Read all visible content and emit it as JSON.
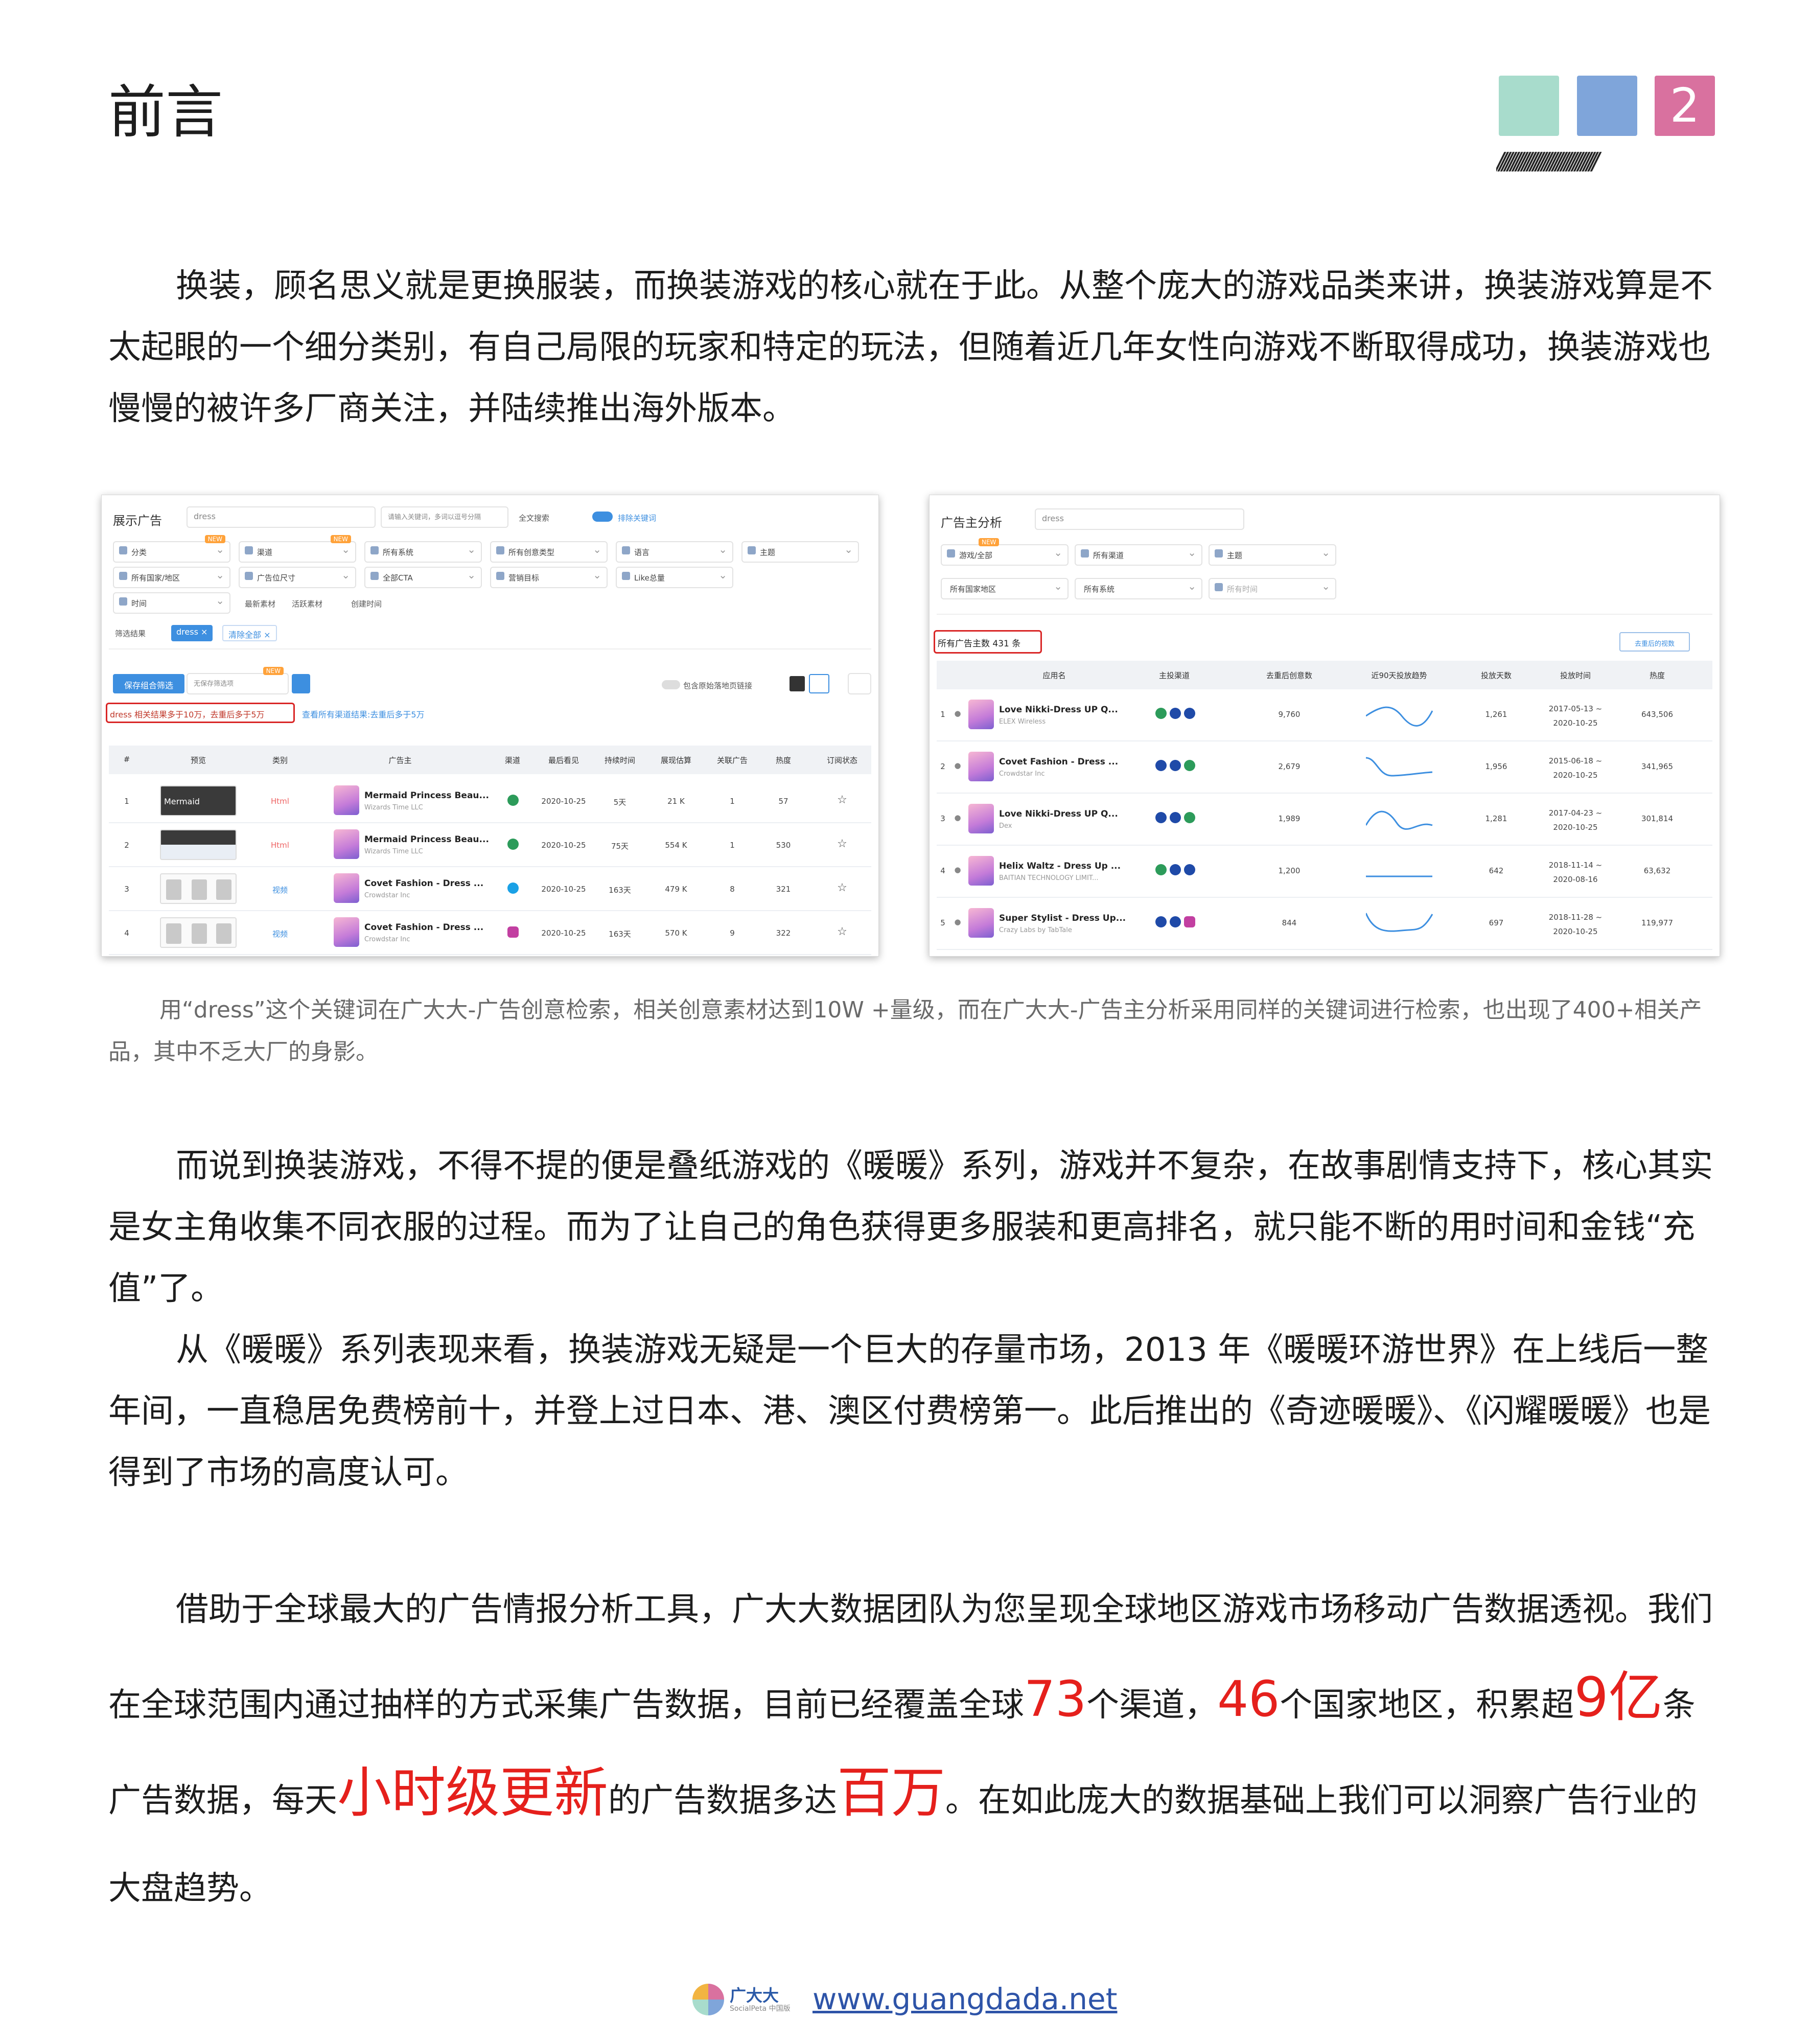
{
  "header": {
    "title": "前言",
    "page_number": "2",
    "slashes": "///////////////////////////////////"
  },
  "intro_paragraph": "换装，顾名思义就是更换服装，而换装游戏的核心就在于此。从整个庞大的游戏品类来讲，换装游戏算是不太起眼的一个细分类别，有自己局限的玩家和特定的玩法，但随着近几年女性向游戏不断取得成功，换装游戏也慢慢的被许多厂商关注，并陆续推出海外版本。",
  "shot_left": {
    "label": "展示广告",
    "search_value": "dress",
    "search_placeholder": "请输入关键词，多词以逗号分隔",
    "fulltext_label": "全文搜索",
    "exclude_label": "排除关键词",
    "filters_row1": [
      "分类",
      "渠道",
      "所有系统",
      "所有创意类型",
      "语言",
      "主题"
    ],
    "filters_row2": [
      "所有国家/地区",
      "广告位尺寸",
      "全部CTA",
      "营销目标",
      "Like总量"
    ],
    "filters_row3": [
      "时间",
      "最新素材",
      "活跃素材",
      "创建时间"
    ],
    "new_badge": "NEW",
    "filter_result_label": "筛选结果",
    "tag_dress": "dress ×",
    "tag_clear": "清除全部 ×",
    "save_btn": "保存组合筛选",
    "save_placeholder": "无保存筛选项",
    "include_label": "包含原始落地页链接",
    "sort_label": "最后看见",
    "result_text": "dress 相关结果多于10万，去重后多于5万",
    "result_link": "查看所有渠道结果:去重后多于5万",
    "columns": [
      "#",
      "预览",
      "类别",
      "广告主",
      "渠道",
      "最后看见",
      "持续时间",
      "展现估算",
      "关联广告",
      "热度",
      "订阅状态"
    ],
    "rows": [
      {
        "n": "1",
        "type": "Html",
        "app": "Mermaid Princess Beau...",
        "dev": "Wizards Time LLC",
        "last": "2020-10-25",
        "dur": "5天",
        "imp": "21 K",
        "rel": "1",
        "heat": "57"
      },
      {
        "n": "2",
        "type": "Html",
        "app": "Mermaid Princess Beau...",
        "dev": "Wizards Time LLC",
        "last": "2020-10-25",
        "dur": "75天",
        "imp": "554 K",
        "rel": "1",
        "heat": "530"
      },
      {
        "n": "3",
        "type": "视频",
        "app": "Covet Fashion - Dress ...",
        "dev": "Crowdstar Inc",
        "last": "2020-10-25",
        "dur": "163天",
        "imp": "479 K",
        "rel": "8",
        "heat": "321"
      },
      {
        "n": "4",
        "type": "视频",
        "app": "Covet Fashion - Dress ...",
        "dev": "Crowdstar Inc",
        "last": "2020-10-25",
        "dur": "163天",
        "imp": "570 K",
        "rel": "9",
        "heat": "322"
      }
    ],
    "thumb_text": "Mermaid"
  },
  "shot_right": {
    "label": "广告主分析",
    "search_value": "dress",
    "filters_row1": [
      "游戏/全部",
      "所有渠道",
      "主题"
    ],
    "filters_row2": [
      "所有国家地区",
      "所有系统",
      "所有时间"
    ],
    "new_badge": "NEW",
    "total_text": "所有广告主数 431 条",
    "dedupe_btn": "去重后的视数",
    "columns": [
      "应用名",
      "主投渠道",
      "去重后创意数",
      "近90天投放趋势",
      "投放天数",
      "投放时间",
      "热度"
    ],
    "rows": [
      {
        "n": "1",
        "app": "Love Nikki-Dress UP Q...",
        "dev": "ELEX Wireless",
        "creatives": "9,760",
        "days": "1,261",
        "time": "2017-05-13 ~ 2020-10-25",
        "heat": "643,506"
      },
      {
        "n": "2",
        "app": "Covet Fashion - Dress ...",
        "dev": "Crowdstar Inc",
        "creatives": "2,679",
        "days": "1,956",
        "time": "2015-06-18 ~ 2020-10-25",
        "heat": "341,965"
      },
      {
        "n": "3",
        "app": "Love Nikki-Dress UP Q...",
        "dev": "Dex",
        "creatives": "1,989",
        "days": "1,281",
        "time": "2017-04-23 ~ 2020-10-25",
        "heat": "301,814"
      },
      {
        "n": "4",
        "app": "Helix Waltz - Dress Up ...",
        "dev": "BAITIAN TECHNOLOGY LIMIT...",
        "creatives": "1,200",
        "days": "642",
        "time": "2018-11-14 ~ 2020-08-16",
        "heat": "63,632"
      },
      {
        "n": "5",
        "app": "Super Stylist - Dress Up...",
        "dev": "Crazy Labs by TabTale",
        "creatives": "844",
        "days": "697",
        "time": "2018-11-28 ~ 2020-10-25",
        "heat": "119,977"
      }
    ]
  },
  "caption": "用“dress”这个关键词在广大大-广告创意检索，相关创意素材达到10W +量级，而在广大大-广告主分析采用同样的关键词进行检索，也出现了400+相关产品，其中不乏大厂的身影。",
  "paragraph2": "而说到换装游戏，不得不提的便是叠纸游戏的《暖暖》系列，游戏并不复杂，在故事剧情支持下，核心其实是女主角收集不同衣服的过程。而为了让自己的角色获得更多服装和更高排名，就只能不断的用时间和金钱“充值”了。",
  "paragraph3": "从《暖暖》系列表现来看，换装游戏无疑是一个巨大的存量市场，2013 年《暖暖环游世界》在上线后一整年间，一直稳居免费榜前十，并登上过日本、港、澳区付费榜第一。此后推出的《奇迹暖暖》、《闪耀暖暖》也是得到了市场的高度认可。",
  "paragraph4": {
    "p1": "借助于全球最大的广告情报分析工具，广大大数据团队为您呈现全球地区游戏市场移动广告数据透视。我们在全球范围内通过抽样的方式采集广告数据，目前已经覆盖全球",
    "n73": "73",
    "p2": "个渠道，",
    "n46": "46",
    "p3": "个国家地区，积累超",
    "n9": "9亿",
    "p4": "条广告数据，每天",
    "hourly": "小时级更新",
    "p5": "的广告数据多达",
    "million": "百万",
    "p6": "。在如此庞大的数据基础上我们可以洞察广告行业的大盘趋势。"
  },
  "footer": {
    "brand": "广大大",
    "brand_sub": "SocialPeta 中国版",
    "url": "www.guangdada.net"
  },
  "colors": {
    "accent_red": "#e5201c",
    "sq1": "#a8dccc",
    "sq2": "#7fa5da",
    "sq3": "#d9719f"
  }
}
